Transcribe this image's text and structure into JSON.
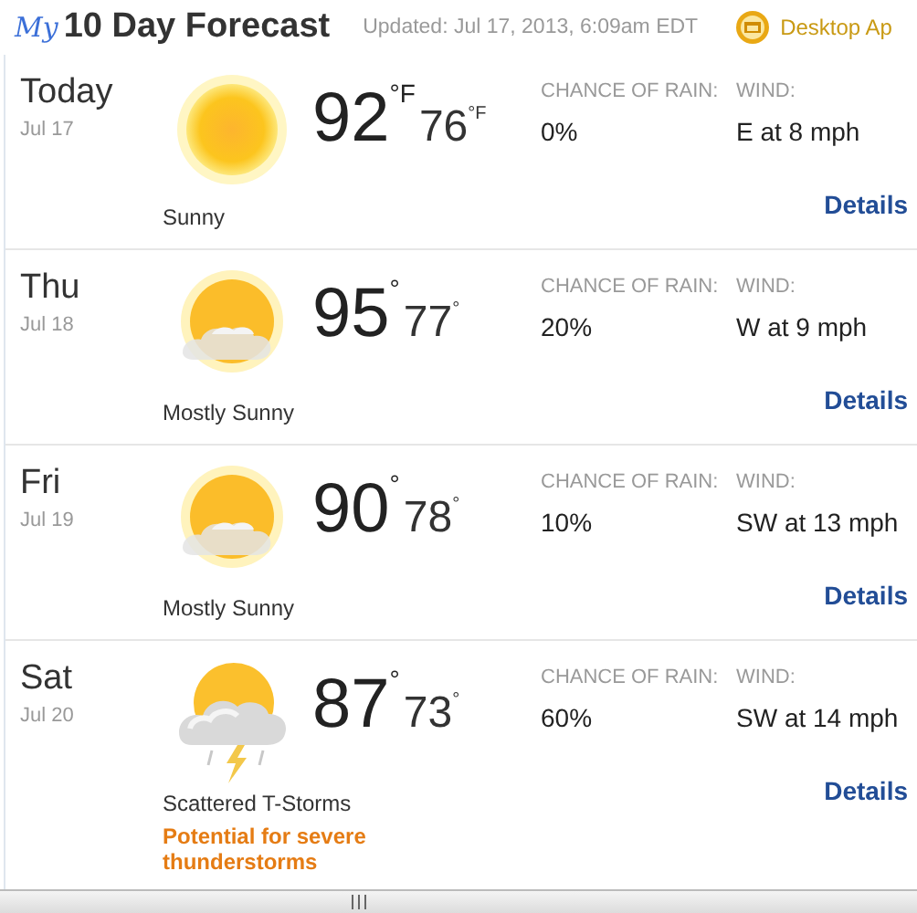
{
  "header": {
    "logo": "My",
    "title": "10 Day Forecast",
    "updated": "Updated: Jul 17, 2013, 6:09am EDT",
    "app_link": "Desktop Ap"
  },
  "days": [
    {
      "day": "Today",
      "date": "Jul 17",
      "kind": "sunny",
      "high": "92",
      "high_unit": "°F",
      "low": "76",
      "low_unit": "°F",
      "condition": "Sunny",
      "rain_label": "CHANCE OF RAIN:",
      "rain": "0%",
      "wind_label": "WIND:",
      "wind": "E at 8 mph",
      "details": "Details"
    },
    {
      "day": "Thu",
      "date": "Jul 18",
      "kind": "mostly_sunny",
      "high": "95",
      "high_unit": "°",
      "low": "77",
      "low_unit": "°",
      "condition": "Mostly Sunny",
      "rain_label": "CHANCE OF RAIN:",
      "rain": "20%",
      "wind_label": "WIND:",
      "wind": "W at 9 mph",
      "details": "Details"
    },
    {
      "day": "Fri",
      "date": "Jul 19",
      "kind": "mostly_sunny",
      "high": "90",
      "high_unit": "°",
      "low": "78",
      "low_unit": "°",
      "condition": "Mostly Sunny",
      "rain_label": "CHANCE OF RAIN:",
      "rain": "10%",
      "wind_label": "WIND:",
      "wind": "SW at 13 mph",
      "details": "Details"
    },
    {
      "day": "Sat",
      "date": "Jul 20",
      "kind": "tstorms",
      "high": "87",
      "high_unit": "°",
      "low": "73",
      "low_unit": "°",
      "condition": "Scattered T-Storms",
      "alert": "Potential for severe thunderstorms",
      "rain_label": "CHANCE OF RAIN:",
      "rain": "60%",
      "wind_label": "WIND:",
      "wind": "SW at 14 mph",
      "details": "Details"
    }
  ]
}
